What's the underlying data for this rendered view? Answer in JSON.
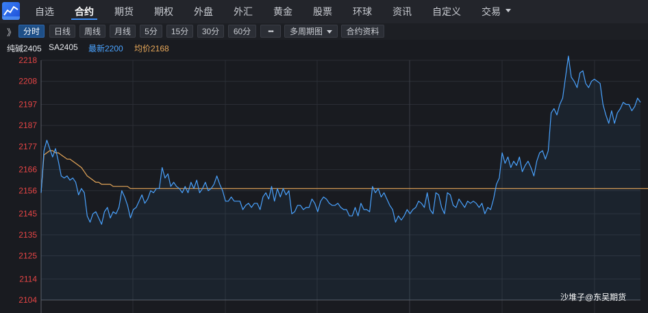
{
  "nav": {
    "logo": "app-chart-logo-icon",
    "items": [
      "自选",
      "合约",
      "期货",
      "期权",
      "外盘",
      "外汇",
      "黄金",
      "股票",
      "环球",
      "资讯",
      "自定义",
      "交易"
    ],
    "active_index": 1
  },
  "toolbar": {
    "collapse_label": "》",
    "buttons": [
      "分时",
      "日线",
      "周线",
      "月线",
      "5分",
      "15分",
      "30分",
      "60分"
    ],
    "active_index": 0,
    "more_label": "•••",
    "multi_period_label": "多周期图",
    "contract_info_label": "合约资料"
  },
  "info": {
    "name": "纯碱2405",
    "code": "SA2405",
    "latest": "最新2200",
    "avg": "均价2168"
  },
  "colors": {
    "price_line": "#4aa3ff",
    "avg_line": "#e8a859",
    "axis_text": "#e64545",
    "grid": "#2b2e35",
    "active_button": "#1e4f87"
  },
  "watermark": "沙堆子@东吴期货",
  "chart_data": {
    "type": "line",
    "y_ticks": [
      "2218",
      "2208",
      "2197",
      "2187",
      "2177",
      "2166",
      "2156",
      "2145",
      "2135",
      "2125",
      "2114",
      "2104"
    ],
    "ylim": [
      2104,
      2218
    ],
    "grid": true,
    "series": [
      {
        "values": [
          2155,
          2175,
          2180,
          2176,
          2172,
          2176,
          2170,
          2163,
          2162,
          2163,
          2161,
          2162,
          2160,
          2154,
          2157,
          2155,
          2144,
          2141,
          2145,
          2146,
          2143,
          2140,
          2146,
          2148,
          2143,
          2146,
          2145,
          2148,
          2156,
          2153,
          2149,
          2143,
          2147,
          2148,
          2151,
          2154,
          2150,
          2152,
          2156,
          2155,
          2157,
          2157,
          2167,
          2162,
          2164,
          2158,
          2160,
          2158,
          2157,
          2155,
          2158,
          2155,
          2160,
          2157,
          2161,
          2155,
          2157,
          2160,
          2156,
          2157,
          2159,
          2163,
          2159,
          2156,
          2151,
          2151,
          2153,
          2151,
          2151,
          2151,
          2147,
          2149,
          2150,
          2148,
          2150,
          2150,
          2147,
          2153,
          2155,
          2152,
          2158,
          2151,
          2157,
          2153,
          2157,
          2154,
          2156,
          2145,
          2146,
          2149,
          2149,
          2147,
          2148,
          2148,
          2152,
          2150,
          2146,
          2151,
          2153,
          2152,
          2150,
          2149,
          2149,
          2150,
          2148,
          2147,
          2147,
          2144,
          2144,
          2148,
          2144,
          2150,
          2147,
          2147,
          2146,
          2158,
          2155,
          2157,
          2153,
          2155,
          2152,
          2149,
          2147,
          2141,
          2144,
          2142,
          2144,
          2147,
          2145,
          2147,
          2148,
          2151,
          2150,
          2148,
          2155,
          2147,
          2145,
          2155,
          2154,
          2148,
          2145,
          2155,
          2154,
          2149,
          2148,
          2152,
          2150,
          2148,
          2151,
          2150,
          2151,
          2150,
          2148,
          2150,
          2145,
          2148,
          2147,
          2152,
          2159,
          2162,
          2174,
          2169,
          2172,
          2167,
          2170,
          2168,
          2172,
          2165,
          2168,
          2170,
          2167,
          2163,
          2170,
          2174,
          2175,
          2171,
          2175,
          2193,
          2195,
          2192,
          2197,
          2200,
          2210,
          2220,
          2210,
          2208,
          2205,
          2212,
          2213,
          2207,
          2205,
          2208,
          2209,
          2208,
          2207,
          2197,
          2192,
          2188,
          2194,
          2188,
          2193,
          2195,
          2198,
          2197,
          2197,
          2194,
          2196,
          2200,
          2198
        ]
      },
      {
        "values": [
          2155,
          2173,
          2174,
          2175,
          2175,
          2174,
          2174,
          2173,
          2172,
          2171,
          2171,
          2170,
          2169,
          2168,
          2167,
          2165,
          2163,
          2162,
          2161,
          2160,
          2160,
          2159,
          2159,
          2159,
          2159,
          2158,
          2158,
          2158,
          2158,
          2158,
          2158,
          2157,
          2157,
          2157,
          2157,
          2157,
          2157,
          2157,
          2157,
          2157,
          2157,
          2157,
          2157,
          2157,
          2157,
          2157,
          2157,
          2157,
          2157,
          2157,
          2157,
          2157,
          2157,
          2157,
          2157,
          2157,
          2157,
          2157,
          2157,
          2157,
          2157,
          2157,
          2157,
          2157,
          2157,
          2157,
          2157,
          2157,
          2157,
          2157,
          2157,
          2157,
          2157,
          2157,
          2157,
          2157,
          2157,
          2157,
          2157,
          2157,
          2157,
          2157,
          2157,
          2157,
          2157,
          2157,
          2157,
          2157,
          2157,
          2157,
          2157,
          2157,
          2157,
          2157,
          2157,
          2157,
          2157,
          2157,
          2157,
          2157,
          2157,
          2157,
          2157,
          2157,
          2157,
          2157,
          2157,
          2157,
          2157,
          2157,
          2157,
          2157,
          2157,
          2157,
          2157,
          2157,
          2157,
          2157,
          2157,
          2157,
          2157,
          2157,
          2157,
          2157,
          2157,
          2157,
          2157,
          2157,
          2157,
          2157,
          2157,
          2157,
          2157,
          2157,
          2157,
          2157,
          2157,
          2157,
          2157,
          2157,
          2157,
          2157,
          2157,
          2157,
          2157,
          2157,
          2157,
          2157,
          2157,
          2157,
          2157,
          2157,
          2157,
          2157,
          2157,
          2157,
          2157,
          2157,
          2157,
          2157,
          2157,
          2157,
          2157,
          2157,
          2157,
          2157,
          2157,
          2157,
          2157,
          2157,
          2157,
          2157,
          2157,
          2157,
          2157,
          2157,
          2157,
          2157,
          2157,
          2157,
          2157,
          2157,
          2157,
          2157,
          2157,
          2157,
          2157,
          2157,
          2157,
          2157,
          2157,
          2157,
          2157,
          2157,
          2157,
          2157,
          2157,
          2157,
          2157,
          2157,
          2157,
          2157,
          2157,
          2157,
          2157,
          2157,
          2157,
          2157,
          2157,
          2157,
          2157,
          2157,
          2157,
          2157,
          2157,
          2157,
          2157
        ]
      }
    ]
  }
}
